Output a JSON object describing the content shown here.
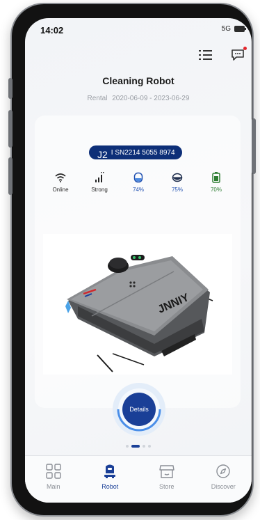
{
  "status_bar": {
    "time": "14:02",
    "network": "5G"
  },
  "header": {
    "title": "Cleaning Robot",
    "rental_label": "Rental",
    "rental_period": "2020-06-09 - 2023-06-29"
  },
  "device": {
    "model": "J2",
    "serial": "I SN2214 5055 8974"
  },
  "stats": [
    {
      "icon": "wifi-icon",
      "label": "Online"
    },
    {
      "icon": "signal-icon",
      "label": "Strong"
    },
    {
      "icon": "water-tank-icon",
      "label": "74%"
    },
    {
      "icon": "dust-bin-icon",
      "label": "75%"
    },
    {
      "icon": "battery-level-icon",
      "label": "70%"
    }
  ],
  "product_image": {
    "brand_mark": "JNNIY"
  },
  "details_button": {
    "label": "Details"
  },
  "pager": {
    "count": 4,
    "active": 1
  },
  "tabs": [
    {
      "icon": "grid-icon",
      "label": "Main",
      "active": false
    },
    {
      "icon": "robot-icon",
      "label": "Robot",
      "active": true
    },
    {
      "icon": "store-icon",
      "label": "Store",
      "active": false
    },
    {
      "icon": "compass-icon",
      "label": "Discover",
      "active": false
    }
  ],
  "colors": {
    "accent": "#1a3f97",
    "pill": "#0d2f78",
    "notification": "#e3242b",
    "battery": "#2e7d32"
  }
}
